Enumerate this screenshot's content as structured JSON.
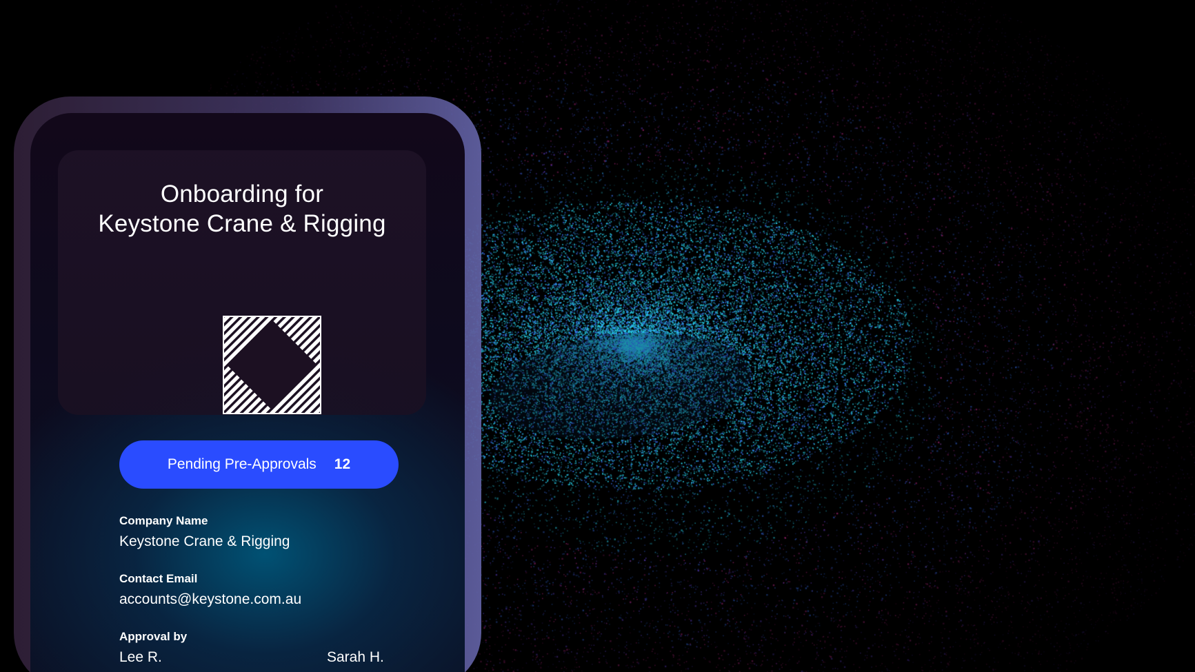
{
  "card": {
    "title_line1": "Onboarding for",
    "title_line2": "Keystone Crane & Rigging",
    "logo_icon": "hatched-diamond-logo-icon"
  },
  "pending": {
    "label": "Pending Pre-Approvals",
    "count": "12",
    "color": "#2a4cff"
  },
  "fields": {
    "company_label": "Company Name",
    "company_value": "Keystone Crane & Rigging",
    "email_label": "Contact Email",
    "email_value": "accounts@keystone.com.au",
    "approval_label": "Approval by",
    "approvers": [
      "Lee R.",
      "Sarah H."
    ]
  },
  "colors": {
    "particle_cyan": "#2ad4e8",
    "particle_blue": "#3a6cff",
    "particle_magenta": "#e0309a"
  }
}
